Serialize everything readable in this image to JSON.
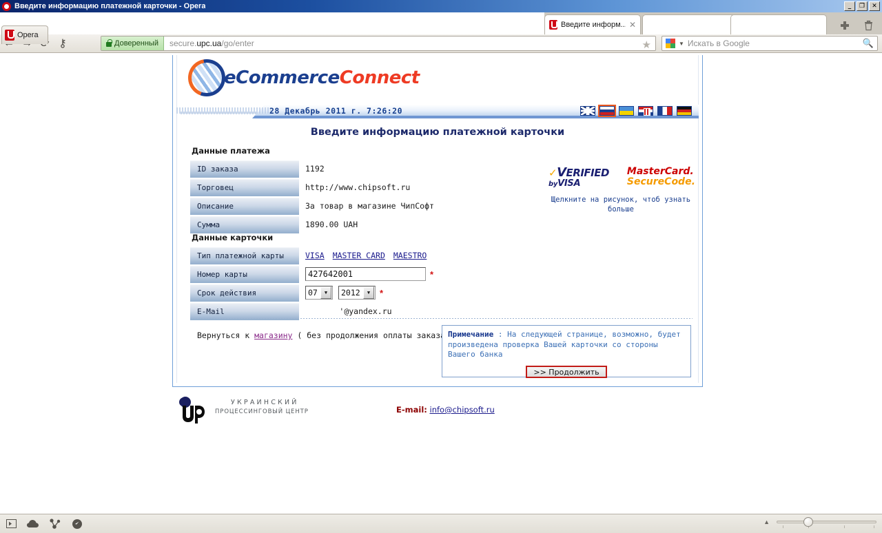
{
  "window": {
    "title": "Введите информацию платежной карточки - Opera",
    "buttons": {
      "minimize": "_",
      "restore": "❐",
      "close": "✕"
    }
  },
  "browser": {
    "menu_button": "Opera",
    "tabs": [
      {
        "label": "Введите информ...",
        "close": "✕",
        "active": true
      }
    ],
    "new_tab_icon": "plus-icon",
    "trash_icon": "trash-icon",
    "nav": {
      "back": "←",
      "forward": "→",
      "reload": "⟳",
      "password": "⚷"
    },
    "address": {
      "trusted_label": "Доверенный",
      "url_prefix": "secure.",
      "url_domain": "upc.ua",
      "url_path": "/go/enter",
      "bookmark_icon": "star-icon"
    },
    "search": {
      "placeholder": "Искать в Google",
      "engine_icon": "google-icon",
      "magnifier_icon": "search-icon"
    },
    "statusbar": {
      "icons": [
        "panels-icon",
        "cloud-icon",
        "share-icon",
        "speeddial-icon"
      ],
      "zoom_caret": "▲"
    }
  },
  "page": {
    "logo": {
      "part1": "eCommerce",
      "part2": "Connect"
    },
    "datetime": "28 Декабрь 2011 г. 7:26:20",
    "flags": [
      {
        "name": "flag-uk",
        "selected": false
      },
      {
        "name": "flag-ru",
        "selected": true
      },
      {
        "name": "flag-ua",
        "selected": false
      },
      {
        "name": "flag-hr",
        "selected": false
      },
      {
        "name": "flag-fr",
        "selected": false
      },
      {
        "name": "flag-de",
        "selected": false
      }
    ],
    "title": "Введите информацию платежной карточки",
    "payment_section": {
      "heading": "Данные платежа",
      "rows": [
        {
          "label": "ID заказа",
          "value": "1192"
        },
        {
          "label": "Торговец",
          "value": "http://www.chipsoft.ru"
        },
        {
          "label": "Описание",
          "value": "За товар в магазине ЧипСофт"
        },
        {
          "label": "Сумма",
          "value": "1890.00 UAH"
        }
      ]
    },
    "card_section": {
      "heading": "Данные карточки",
      "type_label": "Тип платежной карты",
      "card_types": [
        "VISA",
        "MASTER CARD",
        "MAESTRO"
      ],
      "number_label": "Номер карты",
      "number_value": "427642001",
      "expiry_label": "Срок действия",
      "expiry_month": "07",
      "expiry_year": "2012",
      "email_label": "E-Mail",
      "email_value": "'@yandex.ru",
      "required_mark": "*"
    },
    "badges": {
      "visa": {
        "line1_tick": "✓",
        "line1": "ERIFIED",
        "line1_v": "V",
        "line2_by": "by",
        "line2": "VISA"
      },
      "mastercard": {
        "line1": "MasterCard.",
        "line2": "SecureCode."
      },
      "note": "Щелкните на рисунок, чтоб узнать больше"
    },
    "back_line": {
      "prefix": "Вернуться к ",
      "link": "магазину",
      "suffix": " ( без продолжения оплаты заказа )"
    },
    "notice": {
      "label": "Примечание",
      "separator": " : ",
      "text": "На следующей странице, возможно, будет произведена проверка Вашей карточки со стороны Вашего банка",
      "button": ">> Продолжить"
    },
    "footer": {
      "upc_line1": "УКРАИНСКИЙ",
      "upc_line2": "ПРОЦЕССИНГОВЫЙ ЦЕНТР",
      "email_label": "E-mail:",
      "email_link": "info@chipsoft.ru"
    }
  },
  "colors": {
    "brand_blue": "#1b3f8f",
    "brand_orange": "#ee3b24",
    "title_navy": "#1d2a6b",
    "required_red": "#d31515",
    "continue_border": "#c21b17",
    "notice_blue": "#3b6fb5",
    "trusted_green": "#1d4d15"
  }
}
